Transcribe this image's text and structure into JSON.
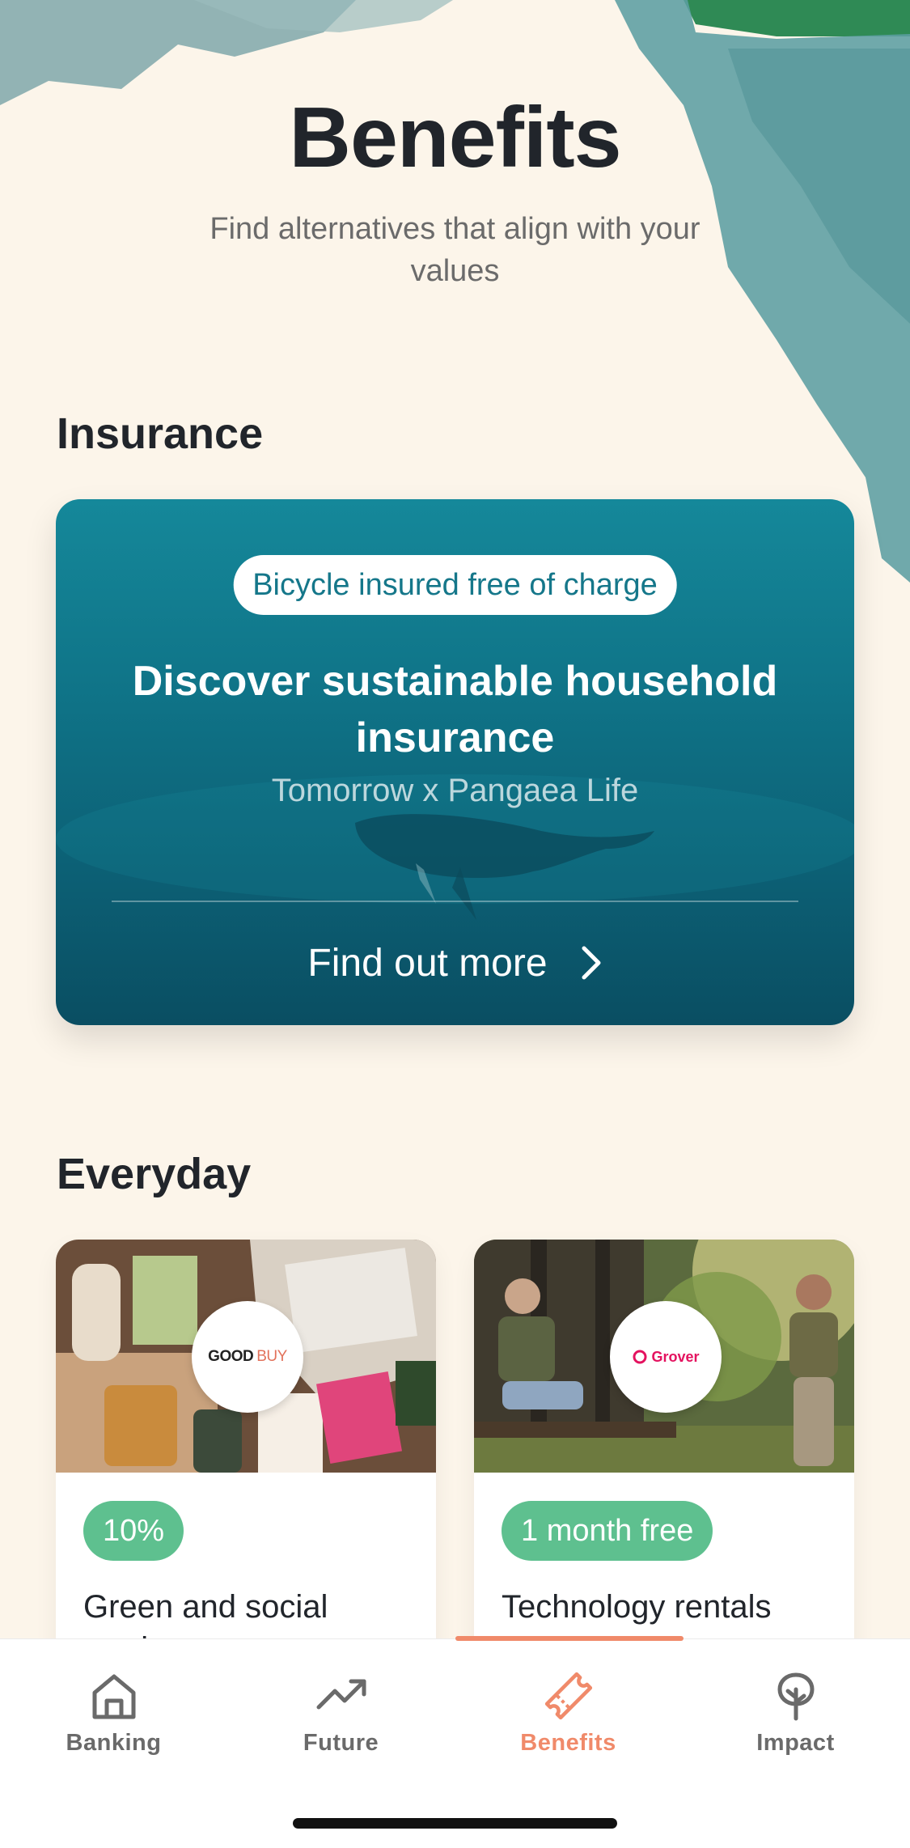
{
  "header": {
    "title": "Benefits",
    "subtitle": "Find alternatives that align with your values"
  },
  "sections": {
    "insurance": {
      "title": "Insurance"
    },
    "everyday": {
      "title": "Everyday"
    }
  },
  "insurance_card": {
    "badge": "Bicycle insured free of charge",
    "title": "Discover sustainable household insurance",
    "partner": "Tomorrow x Pangaea Life",
    "cta": "Find out more",
    "cta_icon": "chevron-right-icon"
  },
  "products": [
    {
      "brand_logo": {
        "part1": "GOOD",
        "part2": "BUY"
      },
      "badge": "10%",
      "title": "Green and social products"
    },
    {
      "brand_logo": {
        "name": "Grover"
      },
      "badge": "1 month free",
      "title": "Technology rentals"
    }
  ],
  "tabbar": {
    "active": "Benefits",
    "tabs": [
      {
        "label": "Banking",
        "icon": "home-icon"
      },
      {
        "label": "Future",
        "icon": "trending-up-icon"
      },
      {
        "label": "Benefits",
        "icon": "ticket-icon"
      },
      {
        "label": "Impact",
        "icon": "tree-icon"
      }
    ]
  },
  "colors": {
    "background": "#fcf5ea",
    "accent": "#f08a6a",
    "badge_green": "#5ec08f",
    "insurance_teal": "#0f7387"
  }
}
